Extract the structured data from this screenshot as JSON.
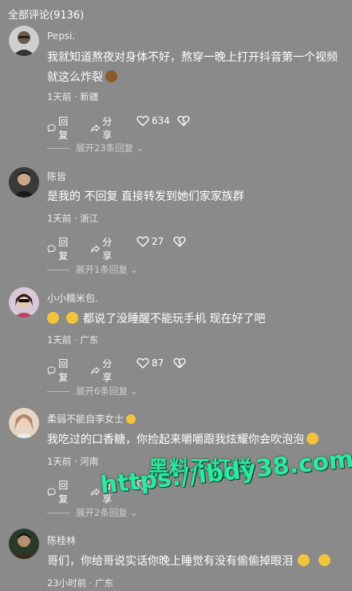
{
  "header": {
    "title": "全部评论(9136)"
  },
  "actions": {
    "reply": "回复",
    "share": "分享"
  },
  "comments": [
    {
      "name": "Pepsi.",
      "text_lines": [
        "我就知道熬夜对身体不好，熬穿一晚上打开抖音第一个视频",
        "就这么炸裂"
      ],
      "time": "1天前 · 新疆",
      "likes": "634",
      "expand": "展开23条回复"
    },
    {
      "name": "陈皆",
      "text_lines": [
        "是我的  不回复  直接转发到她们家家族群"
      ],
      "time": "1天前 · 浙江",
      "likes": "27",
      "expand": "展开1条回复"
    },
    {
      "name": "小小糯米包.",
      "text_lines": [
        "都说了没睡醒不能玩手机  现在好了吧"
      ],
      "time": "1天前 · 广东",
      "likes": "87",
      "expand": "展开6条回复"
    },
    {
      "name": "柔弱不能自李女士",
      "text_lines": [
        "我吃过的口香糖，你捡起来嚼嚼跟我炫耀你会吹泡泡"
      ],
      "time": "1天前 · 河南",
      "likes": "",
      "expand": "展开2条回复"
    },
    {
      "name": "陈桂林",
      "text_lines": [
        "哥们，你给哥说实话你晚上睡觉有没有偷偷掉眼泪"
      ],
      "time": "23小时前 · 广东",
      "likes": "",
      "expand": ""
    }
  ],
  "watermark": {
    "line1": "黑料不打烊",
    "line2": "https://ibdy38.com"
  },
  "colors": {
    "background": "#8a8a8a",
    "watermark": "#2ee8a0"
  }
}
